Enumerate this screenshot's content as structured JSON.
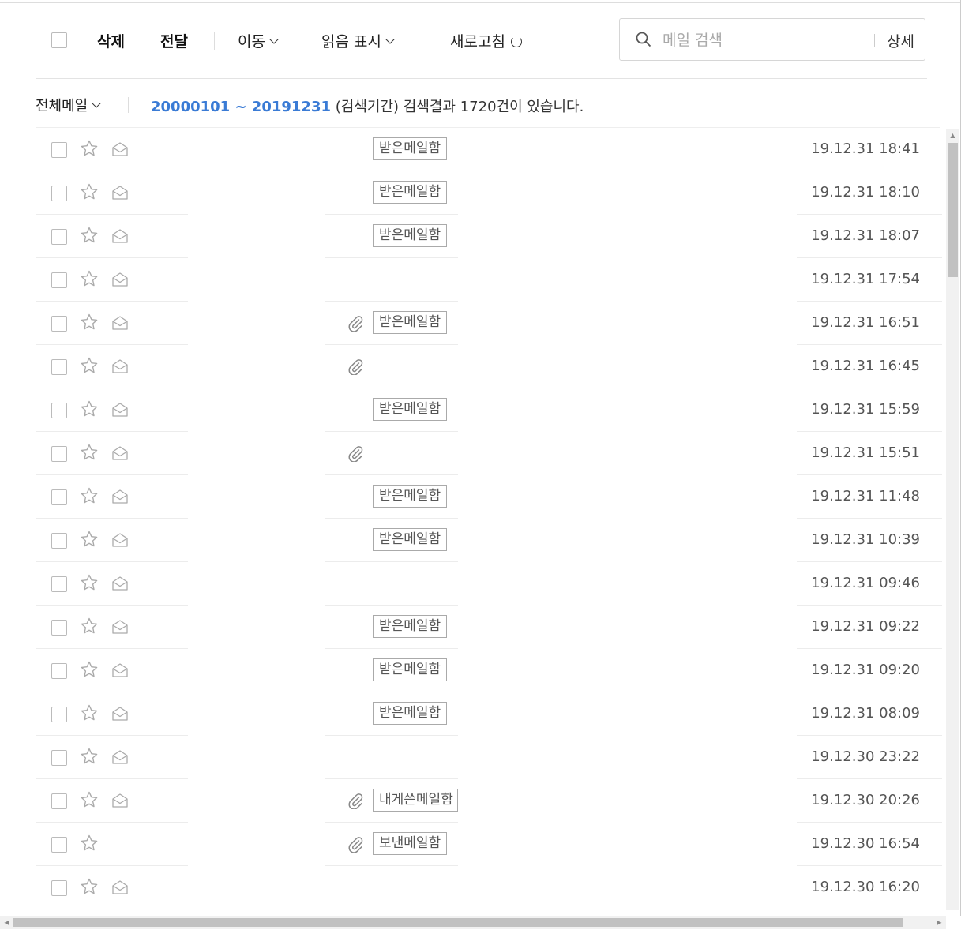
{
  "toolbar": {
    "delete_label": "삭제",
    "forward_label": "전달",
    "move_label": "이동",
    "mark_read_label": "읽음 표시",
    "refresh_label": "새로고침"
  },
  "search": {
    "placeholder": "메일 검색",
    "advanced_label": "상세"
  },
  "filter": {
    "scope_label": "전체메일",
    "date_range": "20000101 ~ 20191231",
    "result_text": "(검색기간) 검색결과 1720건이 있습니다."
  },
  "colors": {
    "accent": "#3a7bd5"
  },
  "mails": [
    {
      "date": "19.12.31 18:41",
      "folder": "받은메일함",
      "attachment": false,
      "read_icon": true
    },
    {
      "date": "19.12.31 18:10",
      "folder": "받은메일함",
      "attachment": false,
      "read_icon": true
    },
    {
      "date": "19.12.31 18:07",
      "folder": "받은메일함",
      "attachment": false,
      "read_icon": true
    },
    {
      "date": "19.12.31 17:54",
      "folder": "",
      "attachment": false,
      "read_icon": true
    },
    {
      "date": "19.12.31 16:51",
      "folder": "받은메일함",
      "attachment": true,
      "read_icon": true
    },
    {
      "date": "19.12.31 16:45",
      "folder": "",
      "attachment": true,
      "read_icon": true
    },
    {
      "date": "19.12.31 15:59",
      "folder": "받은메일함",
      "attachment": false,
      "read_icon": true
    },
    {
      "date": "19.12.31 15:51",
      "folder": "",
      "attachment": true,
      "read_icon": true
    },
    {
      "date": "19.12.31 11:48",
      "folder": "받은메일함",
      "attachment": false,
      "read_icon": true
    },
    {
      "date": "19.12.31 10:39",
      "folder": "받은메일함",
      "attachment": false,
      "read_icon": true
    },
    {
      "date": "19.12.31 09:46",
      "folder": "",
      "attachment": false,
      "read_icon": true
    },
    {
      "date": "19.12.31 09:22",
      "folder": "받은메일함",
      "attachment": false,
      "read_icon": true
    },
    {
      "date": "19.12.31 09:20",
      "folder": "받은메일함",
      "attachment": false,
      "read_icon": true
    },
    {
      "date": "19.12.31 08:09",
      "folder": "받은메일함",
      "attachment": false,
      "read_icon": true
    },
    {
      "date": "19.12.30 23:22",
      "folder": "",
      "attachment": false,
      "read_icon": true
    },
    {
      "date": "19.12.30 20:26",
      "folder": "내게쓴메일함",
      "attachment": true,
      "read_icon": true
    },
    {
      "date": "19.12.30 16:54",
      "folder": "보낸메일함",
      "attachment": true,
      "read_icon": false
    },
    {
      "date": "19.12.30 16:20",
      "folder": "",
      "attachment": false,
      "read_icon": true
    }
  ]
}
